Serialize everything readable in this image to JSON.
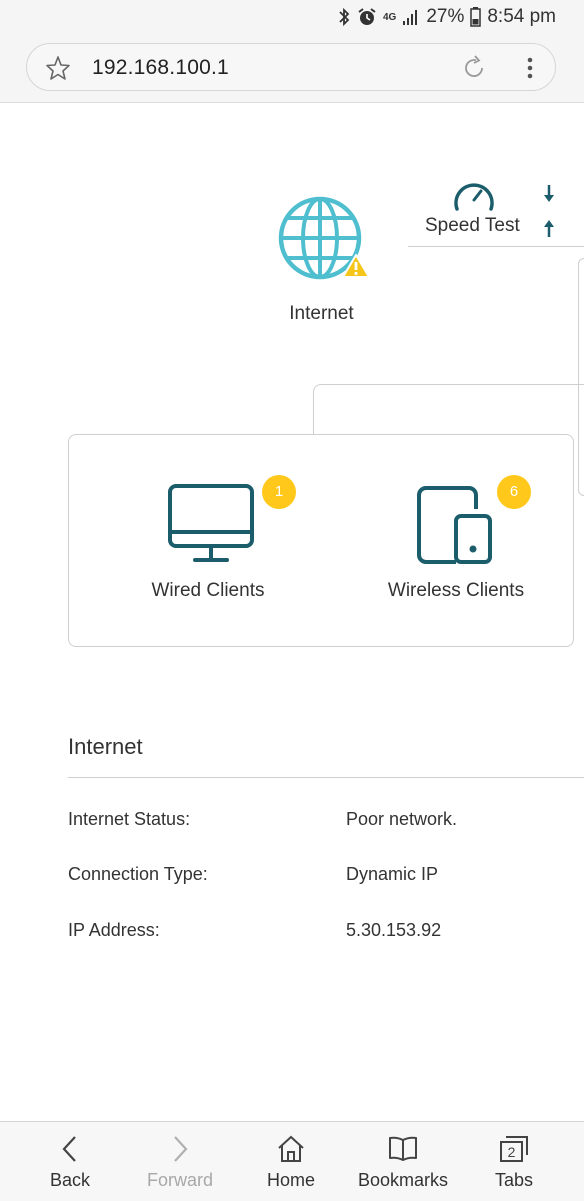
{
  "status_bar": {
    "network": "4G",
    "battery": "27%",
    "time": "8:54 pm"
  },
  "browser": {
    "url": "192.168.100.1"
  },
  "speed_test": {
    "label": "Speed Test"
  },
  "internet": {
    "label": "Internet",
    "status": "warning"
  },
  "clients": {
    "wired": {
      "label": "Wired Clients",
      "count": "1"
    },
    "wireless": {
      "label": "Wireless Clients",
      "count": "6"
    }
  },
  "info": {
    "title": "Internet",
    "rows": [
      {
        "label": "Internet Status:",
        "value": "Poor network."
      },
      {
        "label": "Connection Type:",
        "value": "Dynamic IP"
      },
      {
        "label": "IP Address:",
        "value": "5.30.153.92"
      }
    ]
  },
  "bottom_nav": {
    "items": [
      {
        "label": "Back",
        "icon": "chevron-left-icon",
        "enabled": true
      },
      {
        "label": "Forward",
        "icon": "chevron-right-icon",
        "enabled": false
      },
      {
        "label": "Home",
        "icon": "home-icon",
        "enabled": true
      },
      {
        "label": "Bookmarks",
        "icon": "book-icon",
        "enabled": true
      },
      {
        "label": "Tabs",
        "icon": "tabs-icon",
        "enabled": true,
        "count": "2"
      }
    ]
  },
  "colors": {
    "teal_icon": "#1c5d6b",
    "globe": "#4fbfcf",
    "badge": "#ffc81a",
    "warning": "#f5c518"
  }
}
